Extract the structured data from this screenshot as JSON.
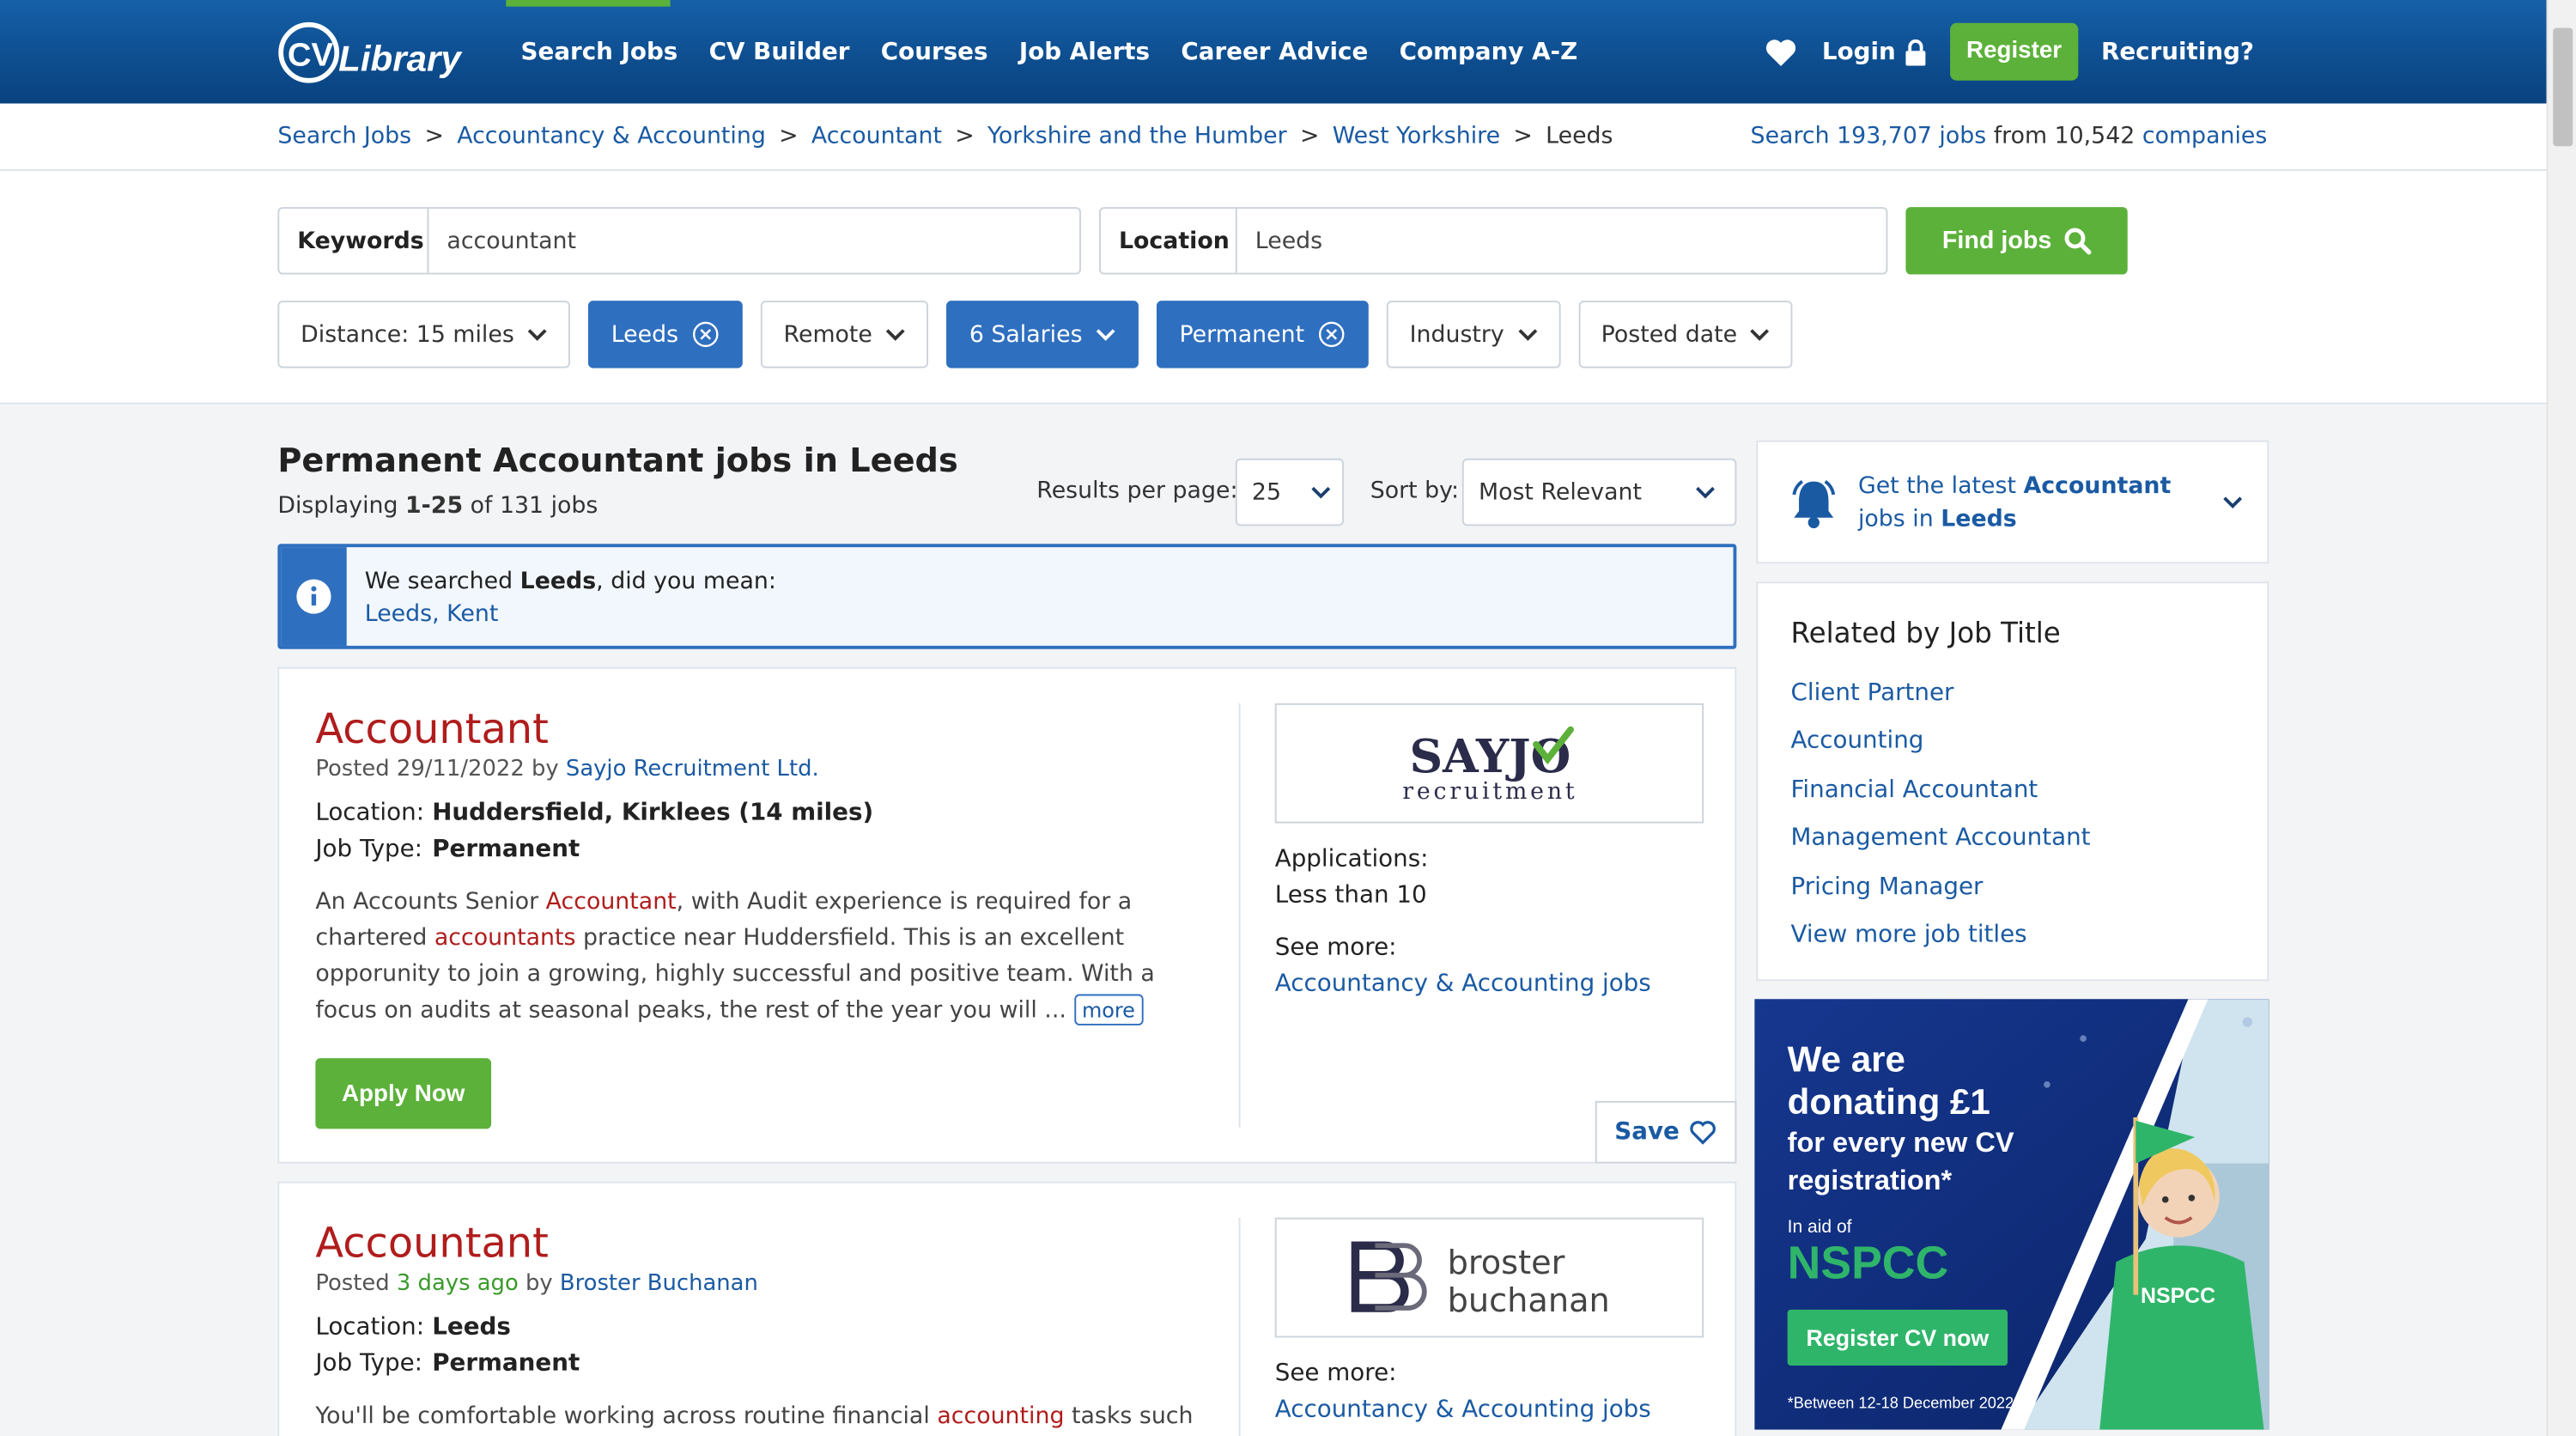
{
  "nav": {
    "logo_text": "CV-Library",
    "items": [
      "Search Jobs",
      "CV Builder",
      "Courses",
      "Job Alerts",
      "Career Advice",
      "Company A-Z"
    ],
    "login": "Login",
    "register": "Register",
    "recruiting": "Recruiting?"
  },
  "breadcrumb": [
    "Search Jobs",
    "Accountancy & Accounting",
    "Accountant",
    "Yorkshire and the Humber",
    "West Yorkshire",
    "Leeds"
  ],
  "stats": {
    "prefix": "Search",
    "jobs": "193,707 jobs",
    "mid": "from 10,542",
    "companies": "companies"
  },
  "search": {
    "keywords_label": "Keywords",
    "keywords_value": "accountant",
    "location_label": "Location",
    "location_value": "Leeds",
    "button": "Find jobs"
  },
  "filters": [
    {
      "label": "Distance: 15 miles",
      "active": false,
      "control": "chevron"
    },
    {
      "label": "Leeds",
      "active": true,
      "control": "clear"
    },
    {
      "label": "Remote",
      "active": false,
      "control": "chevron"
    },
    {
      "label": "6 Salaries",
      "active": true,
      "control": "chevron"
    },
    {
      "label": "Permanent",
      "active": true,
      "control": "clear"
    },
    {
      "label": "Industry",
      "active": false,
      "control": "chevron"
    },
    {
      "label": "Posted date",
      "active": false,
      "control": "chevron"
    }
  ],
  "results": {
    "title": "Permanent Accountant jobs in Leeds",
    "count_prefix": "Displaying",
    "count_range": "1-25",
    "count_suffix": "of 131 jobs",
    "per_page_label": "Results per page:",
    "per_page_value": "25",
    "sort_label": "Sort by:",
    "sort_value": "Most Relevant"
  },
  "info": {
    "prefix": "We searched",
    "term": "Leeds",
    "suffix": ", did you mean:",
    "suggestion": "Leeds, Kent"
  },
  "jobs": [
    {
      "title": "Accountant",
      "posted_prefix": "Posted",
      "posted_date": "29/11/2022",
      "posted_by": "by",
      "company": "Sayjo Recruitment Ltd.",
      "location_label": "Location:",
      "location": "Huddersfield, Kirklees (14 miles)",
      "type_label": "Job Type:",
      "type": "Permanent",
      "desc": [
        {
          "t": "An Accounts Senior ",
          "hl": false
        },
        {
          "t": "Accountant",
          "hl": true
        },
        {
          "t": ", with Audit experience is required for a chartered ",
          "hl": false
        },
        {
          "t": "accountants",
          "hl": true
        },
        {
          "t": " practice near Huddersfield. This is an excellent opporunity to join a growing, highly successful and positive team. With a focus on audits at seasonal peaks, the rest of the year you will ... ",
          "hl": false
        }
      ],
      "more": "more",
      "apply": "Apply Now",
      "logo_line1": "SAYJO",
      "logo_line2": "recruitment",
      "applications_label": "Applications:",
      "applications": "Less than 10",
      "see_more": "See more:",
      "see_more_link": "Accountancy & Accounting jobs",
      "save": "Save"
    },
    {
      "title": "Accountant",
      "posted_prefix": "Posted",
      "posted_date": "3 days ago",
      "posted_by": "by",
      "company": "Broster Buchanan",
      "location_label": "Location:",
      "location": "Leeds",
      "type_label": "Job Type:",
      "type": "Permanent",
      "desc": [
        {
          "t": "You'll be comfortable working across routine financial ",
          "hl": false
        },
        {
          "t": "accounting",
          "hl": true
        },
        {
          "t": " tasks such as",
          "hl": false
        }
      ],
      "logo_line1": "broster",
      "logo_line2": "buchanan",
      "see_more": "See more:",
      "see_more_link": "Accountancy & Accounting jobs"
    }
  ],
  "alert": {
    "prefix": "Get the latest",
    "term": "Accountant",
    "mid": "jobs in",
    "place": "Leeds"
  },
  "related": {
    "heading": "Related by Job Title",
    "items": [
      "Client Partner",
      "Accounting",
      "Financial Accountant",
      "Management Accountant",
      "Pricing Manager",
      "View more job titles"
    ]
  },
  "ad": {
    "line1": "We are",
    "line2": "donating £1",
    "line3": "for every new CV",
    "line4": "registration*",
    "in_aid": "In aid of",
    "charity": "NSPCC",
    "cta": "Register CV now",
    "footnote": "*Between 12-18 December 2022",
    "shirt": "NSPCC"
  },
  "colors": {
    "brand_blue": "#0c4a8a",
    "accent_green": "#5cb13a",
    "link_blue": "#1a5aa3",
    "title_red": "#b01c1c",
    "chip_blue": "#2f6fbf"
  }
}
